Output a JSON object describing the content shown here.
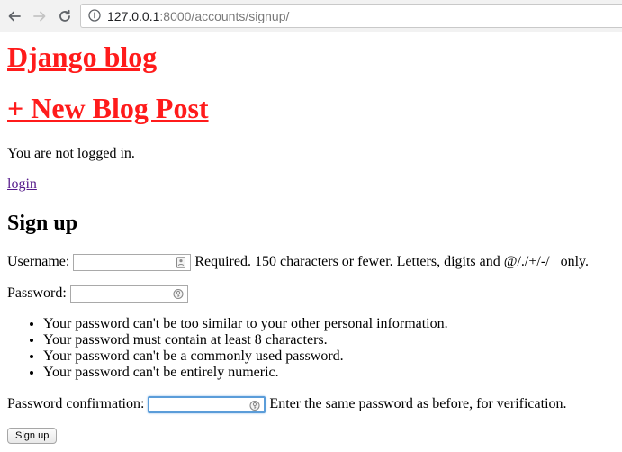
{
  "browser": {
    "url_host": "127.0.0.1",
    "url_rest": ":8000/accounts/signup/",
    "icons": {
      "back": "arrow-left-icon",
      "forward": "arrow-right-icon",
      "reload": "reload-icon",
      "site_info": "info-icon"
    }
  },
  "header": {
    "site_title": "Django blog",
    "new_post_link": "+ New Blog Post",
    "link_color": "#ff1b1b"
  },
  "auth": {
    "status": "You are not logged in.",
    "login_link": "login"
  },
  "signup": {
    "heading": "Sign up",
    "username": {
      "label": "Username:",
      "value": "",
      "help": "Required. 150 characters or fewer. Letters, digits and @/./+/-/_ only."
    },
    "password": {
      "label": "Password:",
      "value": "",
      "help_items": [
        "Your password can't be too similar to your other personal information.",
        "Your password must contain at least 8 characters.",
        "Your password can't be a commonly used password.",
        "Your password can't be entirely numeric."
      ]
    },
    "password_confirmation": {
      "label": "Password confirmation:",
      "value": "",
      "help": "Enter the same password as before, for verification.",
      "focused": true,
      "focus_color": "#5b9dd9"
    },
    "submit_label": "Sign up"
  }
}
